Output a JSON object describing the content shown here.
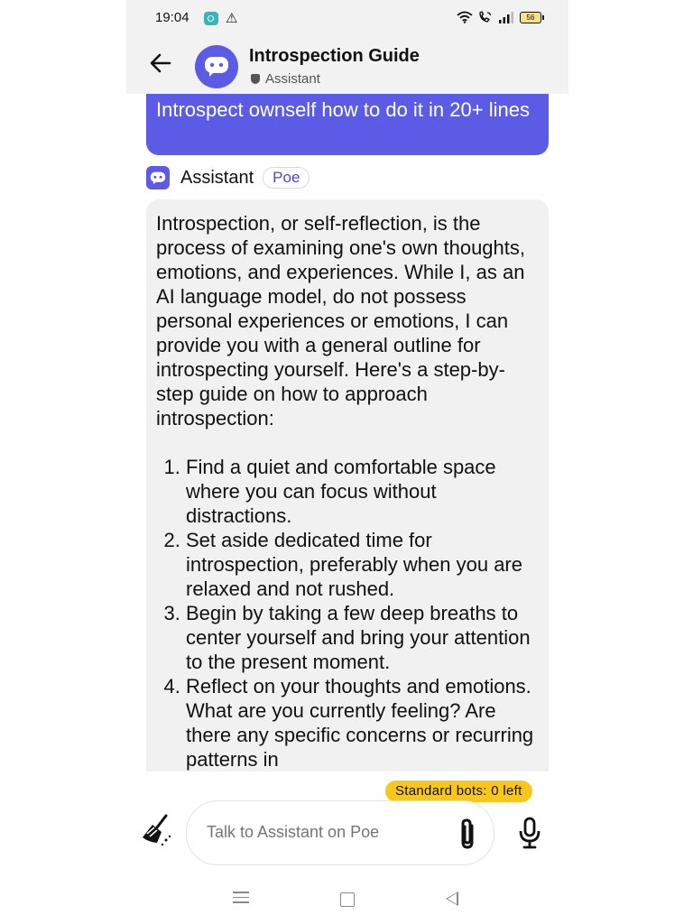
{
  "status_bar": {
    "time": "19:04",
    "battery": "56",
    "icons": [
      "app-notification-icon",
      "warning-icon",
      "wifi-icon",
      "wifi-call-icon",
      "signal-icon",
      "battery-icon"
    ]
  },
  "header": {
    "title": "Introspection Guide",
    "subtitle": "Assistant"
  },
  "user_message": "Introspect ownself how to do it in 20+ lines",
  "assistant": {
    "name": "Assistant",
    "badge": "Poe"
  },
  "answer": {
    "intro": "Introspection, or self-reflection, is the process of examining one's own thoughts, emotions, and experiences. While I, as an AI language model, do not possess personal experiences or emotions, I can provide you with a general outline for introspecting yourself. Here's a step-by-step guide on how to approach introspection:",
    "steps": [
      "Find a quiet and comfortable space where you can focus without distractions.",
      "Set aside dedicated time for introspection, preferably when you are relaxed and not rushed.",
      "Begin by taking a few deep breaths to center yourself and bring your attention to the present moment.",
      "Reflect on your thoughts and emotions. What are you currently feeling? Are there any specific concerns or recurring patterns in"
    ]
  },
  "composer": {
    "quota": "Standard bots: 0 left",
    "placeholder": "Talk to Assistant on Poe"
  },
  "colors": {
    "accent": "#5b5be6",
    "quota_badge": "#f7c81b",
    "answer_bg": "#f1f1f1",
    "header_bg": "#f2f2f2"
  }
}
